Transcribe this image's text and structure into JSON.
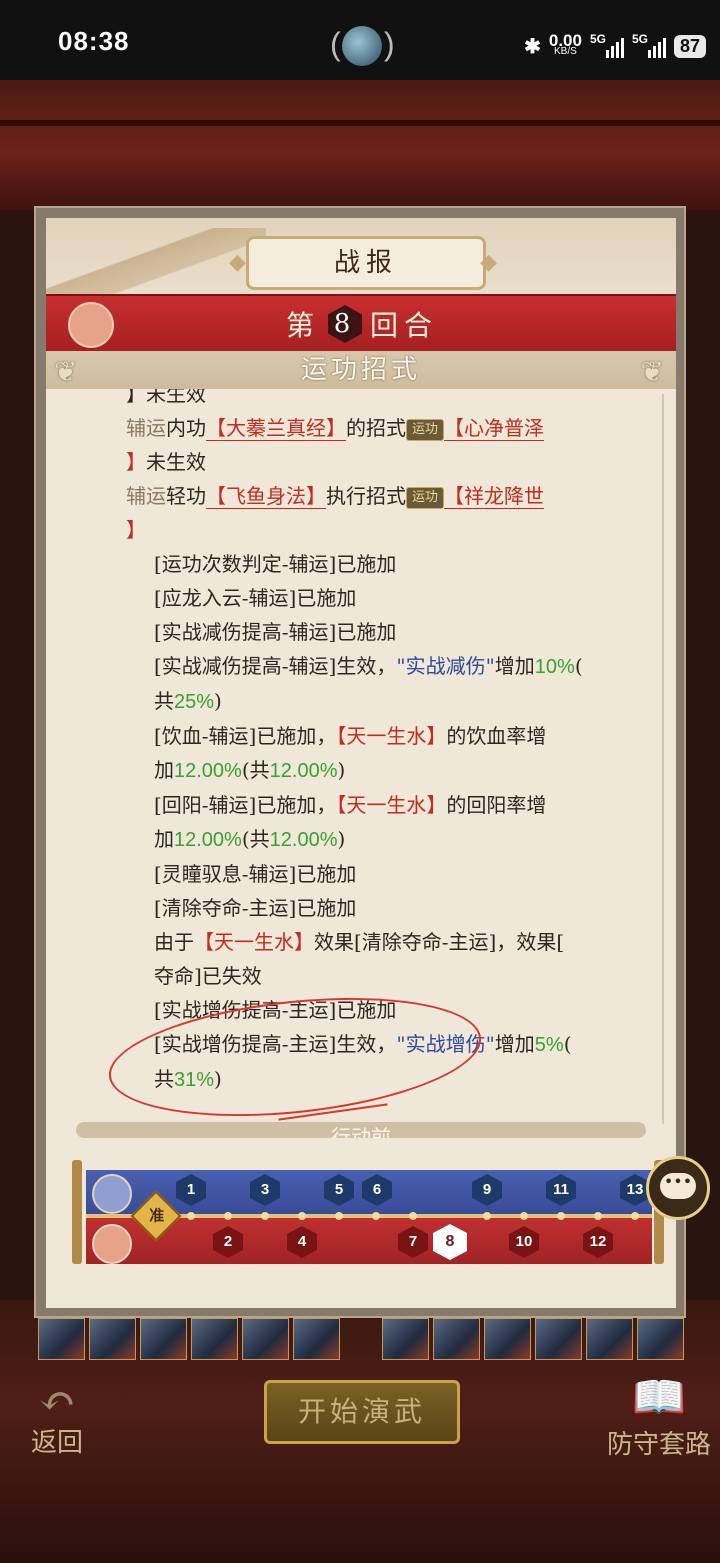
{
  "status": {
    "time": "08:38",
    "net_speed": "0.00",
    "net_unit": "KB/S",
    "sig1": "5G",
    "sig2": "5G",
    "battery": "87"
  },
  "panel": {
    "title": "战报",
    "round_prefix": "第",
    "round_number": "8",
    "round_suffix": "回合",
    "section": "运功招式",
    "next_section": "行动前"
  },
  "log": {
    "l0": "】未生效",
    "l1_a": "辅运",
    "l1_b": "内功",
    "l1_c": "【大蓁兰真经】",
    "l1_d": "的招式",
    "l1_tag": "运功",
    "l1_e": "【心净普泽",
    "l1_f": "】",
    "l1_g": "未生效",
    "l2_a": "辅运",
    "l2_b": "轻功",
    "l2_c": "【飞鱼身法】",
    "l2_d": "执行招式",
    "l2_tag": "运功",
    "l2_e": "【祥龙降世",
    "l2_f": "】",
    "e1": "[运功次数判定-辅运]已施加",
    "e2": "[应龙入云-辅运]已施加",
    "e3": "[实战减伤提高-辅运]已施加",
    "e4_a": "[实战减伤提高-辅运]生效，",
    "e4_b": "\"实战减伤\"",
    "e4_c": "增加",
    "e4_d": "10%",
    "e4_e": "(",
    "e4_f": "共",
    "e4_g": "25%",
    "e4_h": ")",
    "e5_a": "[饮血-辅运]已施加，",
    "e5_b": "【天一生水】",
    "e5_c": "的饮血率增",
    "e5_d": "加",
    "e5_e": "12.00%",
    "e5_f": "(共",
    "e5_g": "12.00%",
    "e5_h": ")",
    "e6_a": "[回阳-辅运]已施加，",
    "e6_b": "【天一生水】",
    "e6_c": "的回阳率增",
    "e6_d": "加",
    "e6_e": "12.00%",
    "e6_f": "(共",
    "e6_g": "12.00%",
    "e6_h": ")",
    "e7": "[灵瞳驭息-辅运]已施加",
    "e8": "[清除夺命-主运]已施加",
    "e9_a": "由于",
    "e9_b": "【天一生水】",
    "e9_c": "效果[清除夺命-主运]，效果[",
    "e9_d": "夺命]已失效",
    "e10": "[实战增伤提高-主运]已施加",
    "e11_a": "[实战增伤提高-主运]生效，",
    "e11_b": "\"实战增伤\"",
    "e11_c": "增加",
    "e11_d": "5%",
    "e11_e": "(",
    "e11_f": "共",
    "e11_g": "31%",
    "e11_h": ")"
  },
  "timeline": {
    "ready_label": "准",
    "blue_turns": [
      "1",
      "3",
      "5",
      "6",
      "9",
      "11",
      "13"
    ],
    "red_turns": [
      "2",
      "4",
      "7",
      "8",
      "10",
      "12"
    ],
    "current_turn": "8"
  },
  "footer": {
    "back": "返回",
    "start": "开始演武",
    "defense": "防守套路"
  },
  "colors": {
    "red_text": "#c22d20",
    "blue_text": "#2f4a9a",
    "green_text": "#3aa030",
    "round_bar": "#c82f2f",
    "annotation": "#d8362e"
  }
}
